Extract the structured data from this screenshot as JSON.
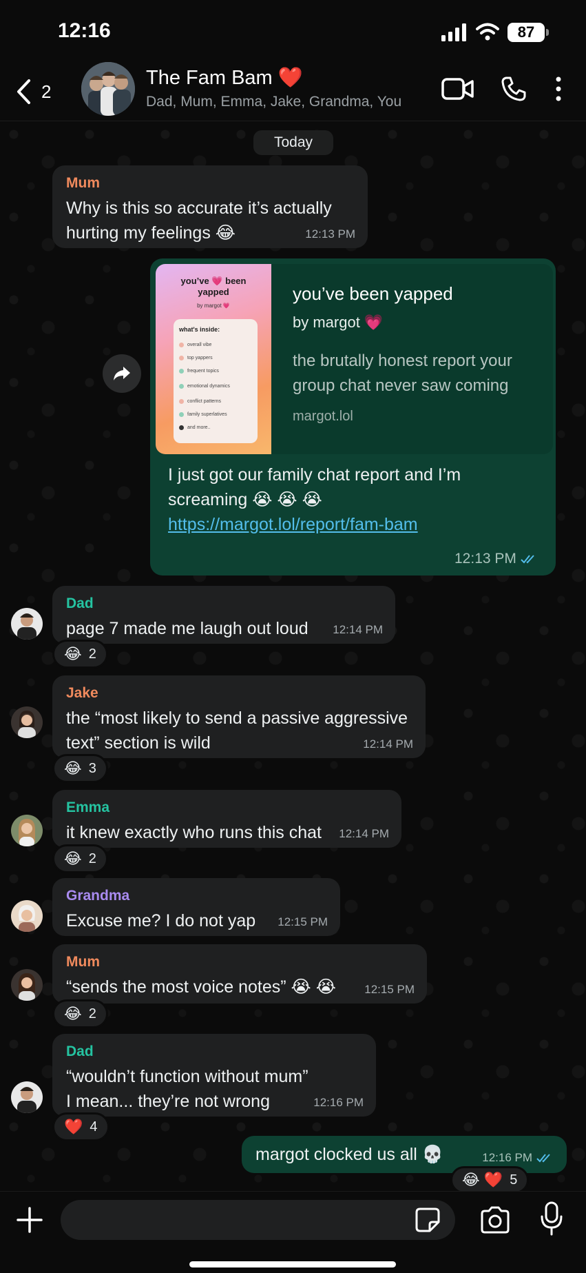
{
  "status_bar": {
    "time": "12:16",
    "battery": "87"
  },
  "header": {
    "back_count": "2",
    "title": "The Fam Bam ❤️",
    "members": "Dad, Mum, Emma, Jake, Grandma, You"
  },
  "date_chip": "Today",
  "messages": [
    {
      "sender": "Mum",
      "sender_color": "#f08a5d",
      "text_1": "Why is this so accurate it’s actually",
      "text_2": "hurting my feelings 😂",
      "time": "12:13 PM"
    },
    {
      "preview": {
        "title": "you’ve been yapped",
        "by": "by margot 💗",
        "description": "the brutally honest report your group chat never saw coming",
        "domain": "margot.lol",
        "thumb_title": "you’ve 💗 been yapped",
        "thumb_by": "by margot 💗",
        "thumb_card_title": "what's inside:",
        "thumb_items": [
          "overall vibe",
          "top yappers",
          "frequent topics",
          "emotional dynamics",
          "conflict patterns",
          "family superlatives",
          "and more.."
        ]
      },
      "text_1": "I just got our family chat report and I’m",
      "text_2": "screaming 😭 😭 😭",
      "link": "https://margot.lol/report/fam-bam",
      "time": "12:13 PM"
    },
    {
      "sender": "Dad",
      "sender_color": "#25c3a1",
      "text": "page 7 made me laugh out loud",
      "time": "12:14 PM",
      "reaction": {
        "emoji": "😂",
        "count": "2"
      }
    },
    {
      "sender": "Jake",
      "sender_color": "#f08a5d",
      "text_1": "the “most likely to send a passive aggressive",
      "text_2": "text” section is wild",
      "time": "12:14 PM",
      "reaction": {
        "emoji": "😂",
        "count": "3"
      }
    },
    {
      "sender": "Emma",
      "sender_color": "#25c3a1",
      "text": "it knew exactly who runs this chat",
      "time": "12:14 PM",
      "reaction": {
        "emoji": "😂",
        "count": "2"
      }
    },
    {
      "sender": "Grandma",
      "sender_color": "#a98bf0",
      "text": "Excuse me? I do not yap",
      "time": "12:15 PM"
    },
    {
      "sender": "Mum",
      "sender_color": "#f08a5d",
      "text": "“sends the most voice notes” 😭 😭",
      "time": "12:15 PM",
      "reaction": {
        "emoji": "😂",
        "count": "2"
      }
    },
    {
      "sender": "Dad",
      "sender_color": "#25c3a1",
      "text_1": "“wouldn’t function without mum”",
      "text_2": "I mean... they’re not wrong",
      "time": "12:16 PM",
      "reaction": {
        "emoji": "❤️",
        "count": "4"
      }
    },
    {
      "text": "margot clocked us all 💀",
      "time": "12:16 PM",
      "reaction": {
        "emoji": "😂 ❤️",
        "count": "5"
      }
    }
  ],
  "composer": {
    "placeholder": ""
  },
  "colors": {
    "outgoing": "#0d4132",
    "incoming": "#1f2021",
    "link": "#53bdeb",
    "ticks": "#53bdeb"
  }
}
